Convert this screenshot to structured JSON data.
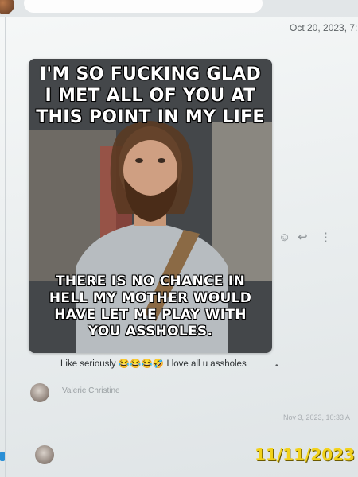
{
  "conversation": {
    "first_timestamp": "Oct 20, 2023, 7:",
    "second_timestamp": "Nov 3, 2023, 10:33 A"
  },
  "meme": {
    "top_lines": [
      "I'M SO FUCKING GLAD",
      "I MET ALL OF YOU AT",
      "THIS POINT IN MY LIFE"
    ],
    "bottom_lines": [
      "THERE IS NO CHANCE IN",
      "HELL MY MOTHER WOULD",
      "HAVE LET ME PLAY WITH",
      "YOU ASSHOLES."
    ]
  },
  "message": {
    "text": "Like seriously 😂😂😂🤣 I love all u assholes",
    "sender": "Valerie Christine"
  },
  "actions": {
    "emoji_icon": "smiley-icon",
    "reply_icon": "reply-arrow-icon",
    "more_icon": "vertical-ellipsis-icon",
    "emoji_glyph": "☺",
    "reply_glyph": "↩",
    "more_glyph": "⋮"
  },
  "photo_date_stamp": "11/11/2023",
  "colors": {
    "date_stamp": "#f2d21b",
    "accent_marker": "#2a8fd6"
  }
}
